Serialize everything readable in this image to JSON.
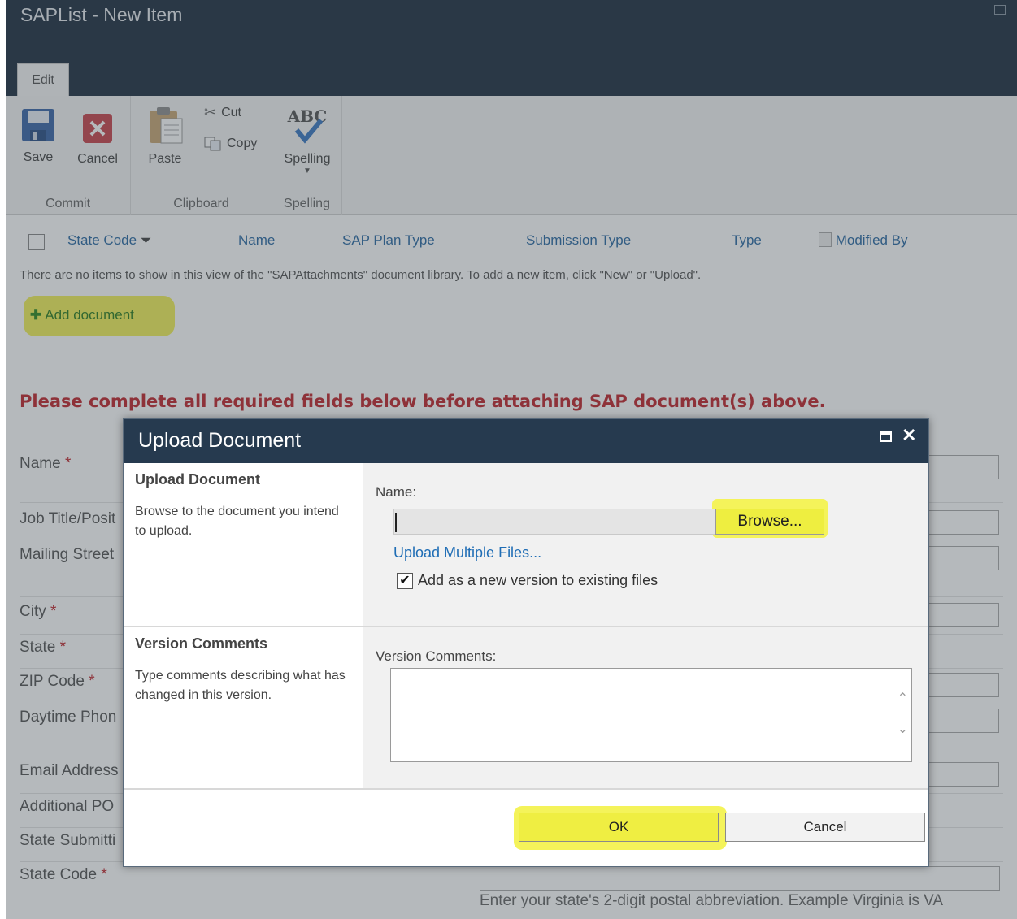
{
  "window": {
    "title": "SAPList - New Item"
  },
  "ribbon": {
    "tab": "Edit",
    "save": "Save",
    "cancel": "Cancel",
    "paste": "Paste",
    "cut": "Cut",
    "copy": "Copy",
    "spelling": "Spelling",
    "groups": {
      "commit": "Commit",
      "clipboard": "Clipboard",
      "spelling": "Spelling"
    }
  },
  "library": {
    "columns": [
      "State Code",
      "Name",
      "SAP Plan Type",
      "Submission Type",
      "Type",
      "Modified By"
    ],
    "empty_message": "There are no items to show in this view of the \"SAPAttachments\" document library. To add a new item, click \"New\" or \"Upload\".",
    "add_document": "Add document"
  },
  "form": {
    "warning": "Please complete all required fields below before attaching SAP document(s) above.",
    "required_mark": "*",
    "fields": {
      "name": "Name",
      "job_title": "Job Title/Posit",
      "mailing_street": "Mailing Street",
      "city": "City",
      "state": "State",
      "zip": "ZIP Code",
      "daytime_phone": "Daytime Phon",
      "email": "Email Address",
      "additional_po": "Additional PO",
      "state_submitting": "State Submitti",
      "state_code": "State Code"
    },
    "state_code_hint": "Enter your state's 2-digit postal abbreviation. Example Virginia is VA"
  },
  "dialog": {
    "title": "Upload Document",
    "section1": {
      "title": "Upload Document",
      "description": "Browse to the document you intend to upload.",
      "name_label": "Name:",
      "browse": "Browse...",
      "upload_multiple": "Upload Multiple Files...",
      "version_checkbox": "Add as a new version to existing files",
      "version_checked": true
    },
    "section2": {
      "title": "Version Comments",
      "description": "Type comments describing what has changed in this version.",
      "label": "Version Comments:"
    },
    "ok": "OK",
    "cancel": "Cancel"
  }
}
